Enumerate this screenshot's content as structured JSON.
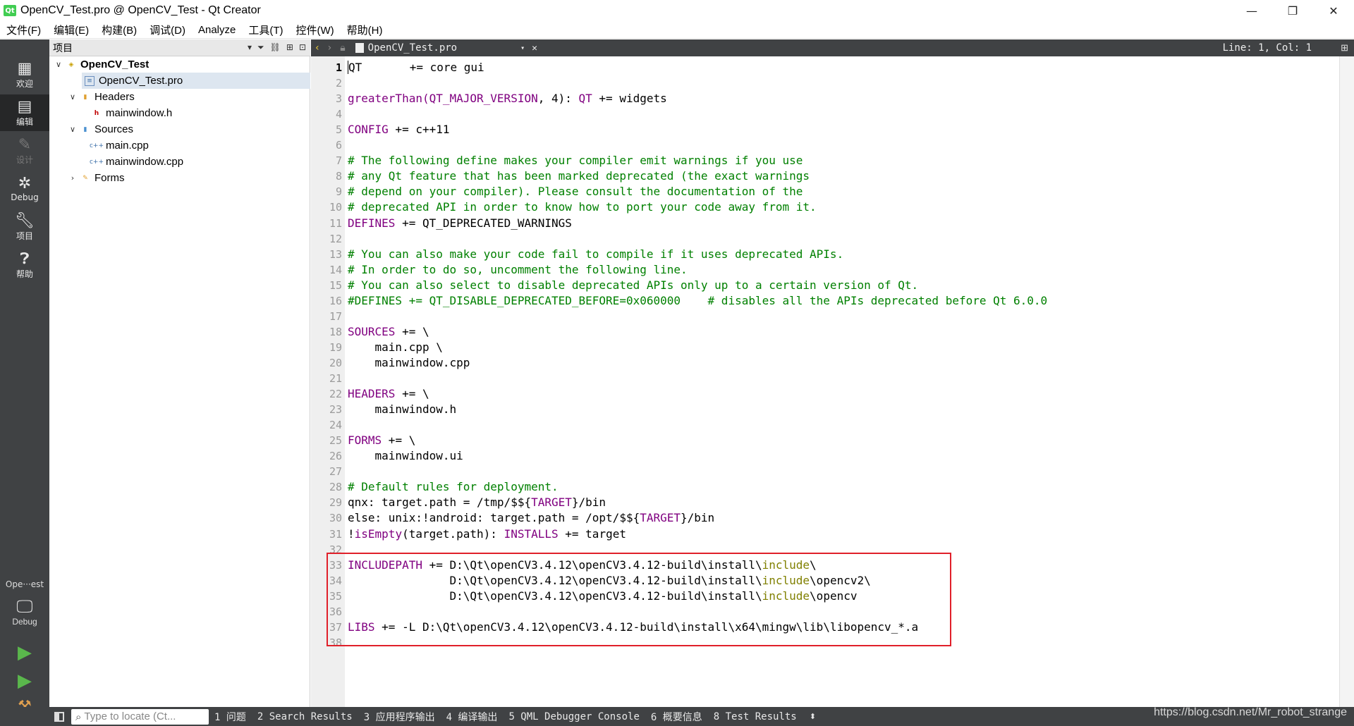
{
  "window": {
    "title": "OpenCV_Test.pro @ OpenCV_Test - Qt Creator",
    "logo_text": "Qt",
    "minimize": "—",
    "restore": "❐",
    "close": "✕"
  },
  "menu": [
    "文件(F)",
    "编辑(E)",
    "构建(B)",
    "调试(D)",
    "Analyze",
    "工具(T)",
    "控件(W)",
    "帮助(H)"
  ],
  "modes": [
    {
      "label": "欢迎",
      "icon": "grid-icon"
    },
    {
      "label": "编辑",
      "icon": "edit-icon"
    },
    {
      "label": "设计",
      "icon": "pen-icon"
    },
    {
      "label": "Debug",
      "icon": "bug-icon"
    },
    {
      "label": "项目",
      "icon": "wrench-icon"
    },
    {
      "label": "帮助",
      "icon": "help-icon"
    }
  ],
  "kit": {
    "project": "Ope···est",
    "label": "Debug"
  },
  "project_panel": {
    "title": "项目",
    "tree": [
      {
        "label": "OpenCV_Test",
        "level": "root"
      },
      {
        "label": "OpenCV_Test.pro",
        "level": "child",
        "selected": true
      },
      {
        "label": "Headers",
        "level": "folder"
      },
      {
        "label": "mainwindow.h",
        "level": "file"
      },
      {
        "label": "Sources",
        "level": "folder"
      },
      {
        "label": "main.cpp",
        "level": "file"
      },
      {
        "label": "mainwindow.cpp",
        "level": "file"
      },
      {
        "label": "Forms",
        "level": "folder"
      }
    ]
  },
  "editor": {
    "file": "OpenCV_Test.pro",
    "position": "Line: 1, Col: 1",
    "lines": [
      [
        {
          "t": "QT       += core gui"
        }
      ],
      [
        {
          "t": ""
        }
      ],
      [
        {
          "t": "greaterThan(",
          "c": "kw"
        },
        {
          "t": "QT_MAJOR_VERSION",
          "c": "kw"
        },
        {
          "t": ", 4): "
        },
        {
          "t": "QT",
          "c": "kw"
        },
        {
          "t": " += widgets"
        }
      ],
      [
        {
          "t": ""
        }
      ],
      [
        {
          "t": "CONFIG",
          "c": "kw"
        },
        {
          "t": " += c++11"
        }
      ],
      [
        {
          "t": ""
        }
      ],
      [
        {
          "t": "# The following define makes your compiler emit warnings if you use",
          "c": "cm"
        }
      ],
      [
        {
          "t": "# any Qt feature that has been marked deprecated (the exact warnings",
          "c": "cm"
        }
      ],
      [
        {
          "t": "# depend on your compiler). Please consult the documentation of the",
          "c": "cm"
        }
      ],
      [
        {
          "t": "# deprecated API in order to know how to port your code away from it.",
          "c": "cm"
        }
      ],
      [
        {
          "t": "DEFINES",
          "c": "kw"
        },
        {
          "t": " += QT_DEPRECATED_WARNINGS"
        }
      ],
      [
        {
          "t": ""
        }
      ],
      [
        {
          "t": "# You can also make your code fail to compile if it uses deprecated APIs.",
          "c": "cm"
        }
      ],
      [
        {
          "t": "# In order to do so, uncomment the following line.",
          "c": "cm"
        }
      ],
      [
        {
          "t": "# You can also select to disable deprecated APIs only up to a certain version of Qt.",
          "c": "cm"
        }
      ],
      [
        {
          "t": "#DEFINES += QT_DISABLE_DEPRECATED_BEFORE=0x060000    # disables all the APIs deprecated before Qt 6.0.0",
          "c": "cm"
        }
      ],
      [
        {
          "t": ""
        }
      ],
      [
        {
          "t": "SOURCES",
          "c": "kw"
        },
        {
          "t": " += \\"
        }
      ],
      [
        {
          "t": "    main.cpp \\"
        }
      ],
      [
        {
          "t": "    mainwindow.cpp"
        }
      ],
      [
        {
          "t": ""
        }
      ],
      [
        {
          "t": "HEADERS",
          "c": "kw"
        },
        {
          "t": " += \\"
        }
      ],
      [
        {
          "t": "    mainwindow.h"
        }
      ],
      [
        {
          "t": ""
        }
      ],
      [
        {
          "t": "FORMS",
          "c": "kw"
        },
        {
          "t": " += \\"
        }
      ],
      [
        {
          "t": "    mainwindow.ui"
        }
      ],
      [
        {
          "t": ""
        }
      ],
      [
        {
          "t": "# Default rules for deployment.",
          "c": "cm"
        }
      ],
      [
        {
          "t": "qnx: target.path = /tmp/$${"
        },
        {
          "t": "TARGET",
          "c": "kw"
        },
        {
          "t": "}/bin"
        }
      ],
      [
        {
          "t": "else: unix:!android: target.path = /opt/$${"
        },
        {
          "t": "TARGET",
          "c": "kw"
        },
        {
          "t": "}/bin"
        }
      ],
      [
        {
          "t": "!"
        },
        {
          "t": "isEmpty",
          "c": "kw"
        },
        {
          "t": "(target.path): "
        },
        {
          "t": "INSTALLS",
          "c": "kw"
        },
        {
          "t": " += target"
        }
      ],
      [
        {
          "t": ""
        }
      ],
      [
        {
          "t": "INCLUDEPATH",
          "c": "kw"
        },
        {
          "t": " += D:\\Qt\\openCV3.4.12\\openCV3.4.12-build\\install\\"
        },
        {
          "t": "include",
          "c": "inc"
        },
        {
          "t": "\\"
        }
      ],
      [
        {
          "t": "               D:\\Qt\\openCV3.4.12\\openCV3.4.12-build\\install\\"
        },
        {
          "t": "include",
          "c": "inc"
        },
        {
          "t": "\\opencv2\\"
        }
      ],
      [
        {
          "t": "               D:\\Qt\\openCV3.4.12\\openCV3.4.12-build\\install\\"
        },
        {
          "t": "include",
          "c": "inc"
        },
        {
          "t": "\\opencv"
        }
      ],
      [
        {
          "t": ""
        }
      ],
      [
        {
          "t": "LIBS",
          "c": "kw"
        },
        {
          "t": " += -L D:\\Qt\\openCV3.4.12\\openCV3.4.12-build\\install\\x64\\mingw\\lib\\libopencv_*.a"
        }
      ],
      [
        {
          "t": ""
        }
      ]
    ]
  },
  "status": {
    "locator_placeholder": "Type to locate (Ct...",
    "output_tabs": [
      "1 问题",
      "2 Search Results",
      "3 应用程序输出",
      "4 编译输出",
      "5 QML Debugger Console",
      "6 概要信息",
      "8 Test Results"
    ],
    "watermark": "https://blog.csdn.net/Mr_robot_strange"
  },
  "colors": {
    "keyword": "#800080",
    "comment": "#008000",
    "include": "#808000",
    "highlight_box": "#e0202a"
  }
}
